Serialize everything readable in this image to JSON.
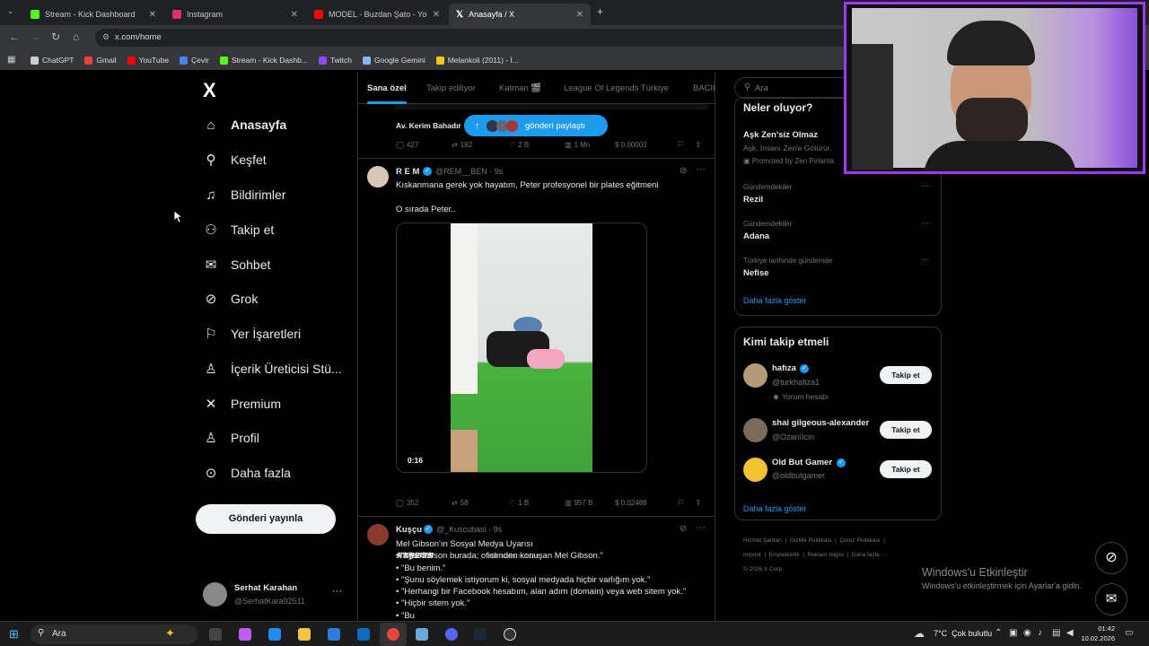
{
  "browser": {
    "tabs": [
      {
        "title": "Stream - Kick Dashboard",
        "color": "#53fc18"
      },
      {
        "title": "Instagram",
        "color": "#e1306c"
      },
      {
        "title": "MODEL - Buzdan Şato - YouTube",
        "color": "#ff0000"
      },
      {
        "title": "Anasayfa / X",
        "color": "#ffffff"
      }
    ],
    "url": "x.com/home",
    "bookmarks": [
      {
        "label": "ChatGPT",
        "color": "#ccc"
      },
      {
        "label": "Gmail",
        "color": "#ea4335"
      },
      {
        "label": "YouTube",
        "color": "#ff0000"
      },
      {
        "label": "Çevir",
        "color": "#4285f4"
      },
      {
        "label": "Stream - Kick Dashb...",
        "color": "#53fc18"
      },
      {
        "label": "Twitch",
        "color": "#9146ff"
      },
      {
        "label": "Google Gemini",
        "color": "#8ab4f8"
      },
      {
        "label": "Melankoli (2011) - İ...",
        "color": "#f5c518"
      }
    ]
  },
  "nav": {
    "logo": "X",
    "items": [
      {
        "label": "Anasayfa",
        "icon": "home-icon"
      },
      {
        "label": "Keşfet",
        "icon": "search-icon"
      },
      {
        "label": "Bildirimler",
        "icon": "bell-icon"
      },
      {
        "label": "Takip et",
        "icon": "person-plus-icon"
      },
      {
        "label": "Sohbet",
        "icon": "mail-icon"
      },
      {
        "label": "Grok",
        "icon": "grok-icon"
      },
      {
        "label": "Yer İşaretleri",
        "icon": "bookmark-icon"
      },
      {
        "label": "İçerik Üreticisi Stü...",
        "icon": "creator-icon"
      },
      {
        "label": "Premium",
        "icon": "x-premium-icon"
      },
      {
        "label": "Profil",
        "icon": "person-icon"
      },
      {
        "label": "Daha fazla",
        "icon": "more-circle-icon"
      }
    ],
    "post_button": "Gönderi yayınla",
    "account": {
      "name": "Serhat Karahan",
      "handle": "@SerhatKara92511",
      "more": "···"
    }
  },
  "timeline": {
    "tabs": [
      "Sana özel",
      "Takip ediliyor",
      "Katman 🎬",
      "League Of Legends Türkiye",
      "BACIL"
    ],
    "share_pill": "gönderi paylaştı",
    "prev_post": {
      "author_partial": "Av. Kerim Bahadır",
      "replies": "427",
      "reposts": "182",
      "likes": "2 B",
      "views": "1 Mn",
      "tip": "$ 0.00003"
    },
    "post1": {
      "name": "R E M",
      "handle": "@REM__BEN · 9s",
      "line1": "Kıskanmana gerek yok hayatım, Peter profesyonel bir plates eğitmeni",
      "line2": "O sırada Peter..",
      "video_time": "0:16",
      "footer_name": "𝕽𝕬𝖄𝖂𝕬𝕹",
      "footer_text": "adlı kullanıcıdan",
      "replies": "352",
      "reposts": "58",
      "likes": "1 B",
      "views": "957 B",
      "tip": "$ 0.02488"
    },
    "post2": {
      "name": "Kuşçu",
      "handle": "@_Kuscubasi · 9s",
      "lines": [
        "Mel Gibson'ın Sosyal Medya Uyarısı",
        "• \"Mel Gibson burada; ofisimden konuşan Mel Gibson.\"",
        "• \"Bu benim.\"",
        "• \"Şunu söylemek istiyorum ki, sosyal medyada hiçbir varlığım yok.\"",
        "• \"Herhangi bir Facebook hesabım, alan adım (domain) veya web sitem yok.\"",
        "• \"Hiçbir sitem yok.\"",
        "• \"Bu"
      ]
    }
  },
  "sidebar": {
    "search_placeholder": "Ara",
    "trends_title": "Neler oluyor?",
    "promo": {
      "title": "Aşk Zen'siz Olmaz",
      "sub": "Aşk, İnsanı Zen'e Götürür.",
      "promoted": "Promoted by Zen Pırlanta"
    },
    "trends": [
      {
        "category": "Gündemdekiler",
        "name": "Rezil"
      },
      {
        "category": "Gündemdekiler",
        "name": "Adana"
      },
      {
        "category": "Türkiye tarihinde gündemde",
        "name": "Nefise"
      }
    ],
    "show_more": "Daha fazla göster",
    "who_to_follow": "Kimi takip etmeli",
    "follow_label": "Takip et",
    "suggestions": [
      {
        "name": "hafıza",
        "handle": "@turkhafiza1",
        "extra": "Yorum hesabı",
        "verified": true
      },
      {
        "name": "shai gilgeous-alexander",
        "handle": "@OzanIIcin",
        "extra": "",
        "verified": false
      },
      {
        "name": "Old But Gamer",
        "handle": "@oldbutgamer",
        "extra": "",
        "verified": true
      }
    ],
    "footer_links": [
      "Hizmet Şartları",
      "Gizlilik Politikası",
      "Çerez Politikası",
      "Imprint",
      "Erişilebilirlik",
      "Reklam bilgisi",
      "Daha fazla ···"
    ],
    "copyright": "© 2026 X Corp."
  },
  "windows": {
    "activate_title": "Windows'u Etkinleştir",
    "activate_sub": "Windows'u etkinleştirmek için Ayarlar'a gidin.",
    "search": "Ara",
    "weather": "7°C  Çok bulutlu",
    "time": "01:42",
    "date": "10.02.2026"
  },
  "colors": {
    "accent": "#1d9bf0",
    "verified": "#1d9bf0",
    "webcam_border": "#a238ff"
  }
}
